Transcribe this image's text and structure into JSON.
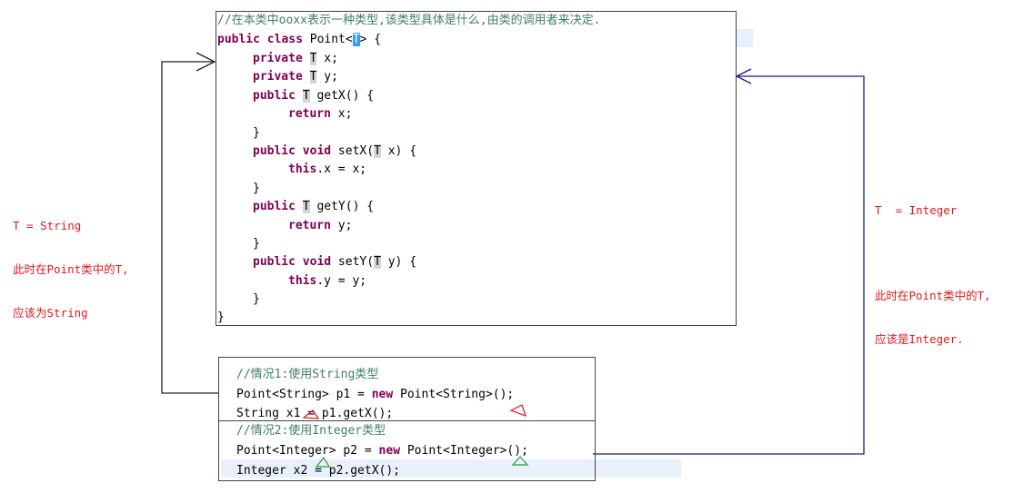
{
  "point_class": {
    "comment": "//在本类中ooxx表示一种类型,该类型具体是什么,由类的调用者来决定.",
    "header_kw": "public class",
    "header_name": " Point<",
    "header_T": "T",
    "header_end": "> {",
    "lines": [
      {
        "kw": "private",
        "t": "T",
        "rest": " x;"
      },
      {
        "kw": "private",
        "t": "T",
        "rest": " y;"
      },
      {
        "kw": "public",
        "t": "T",
        "rest": " getX() {"
      },
      {
        "kw": "return",
        "rest": " x;"
      },
      {
        "plain": "}"
      },
      {
        "kw": "public void",
        "pre": " setX(",
        "t": "T",
        "rest": " x) {"
      },
      {
        "kw": "this",
        "rest": ".x = x;"
      },
      {
        "plain": "}"
      },
      {
        "kw": "public",
        "t": "T",
        "rest": " getY() {"
      },
      {
        "kw": "return",
        "rest": " y;"
      },
      {
        "plain": "}"
      },
      {
        "kw": "public void",
        "pre": " setY(",
        "t": "T",
        "rest": " y) {"
      },
      {
        "kw": "this",
        "rest": ".y = y;"
      },
      {
        "plain": "}"
      }
    ],
    "close": "}"
  },
  "case1": {
    "comment": "//情况1:使用String类型",
    "line1_a": "Point<String> p1 = ",
    "line1_new": "new",
    "line1_b": " Point<String>();",
    "line2": "String x1 = p1.getX();"
  },
  "case2": {
    "comment": "//情况2:使用Integer类型",
    "line1_a": "Point<Integer> p2 = ",
    "line1_new": "new",
    "line1_b": " Point<Integer>();",
    "line2": "Integer x2 = p2.getX();"
  },
  "note_left": {
    "line1": "T = String",
    "line2": "此时在Point类中的T,",
    "line3": "应该为String"
  },
  "note_right": {
    "line1": "T  = Integer",
    "line2": "此时在Point类中的T,",
    "line3": "应该是Integer."
  },
  "colors": {
    "keyword": "#7f0055",
    "comment": "#3f7f5f",
    "annotation": "#e8161a",
    "arrow_left": "#222222",
    "arrow_right": "#1a1a8c"
  }
}
